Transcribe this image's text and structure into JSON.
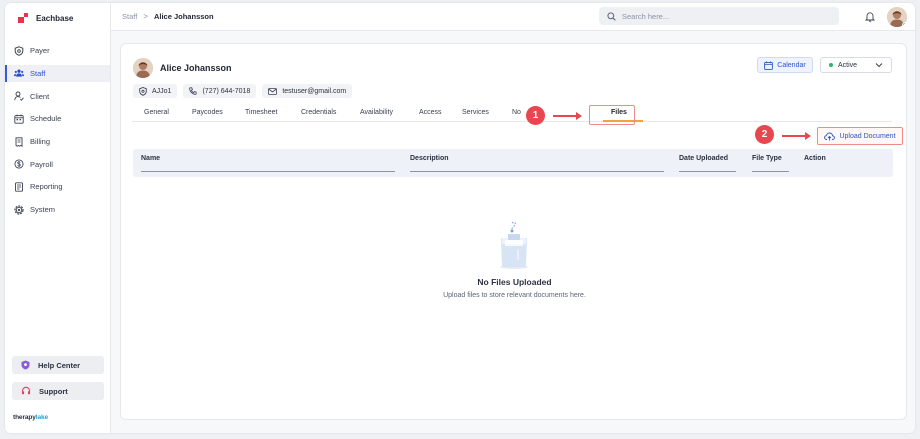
{
  "app": {
    "brand": "Eachbase"
  },
  "sidebar": {
    "items": [
      {
        "label": "Payer",
        "icon": "shield-icon",
        "active": false
      },
      {
        "label": "Staff",
        "icon": "users-icon",
        "active": true
      },
      {
        "label": "Client",
        "icon": "client-icon",
        "active": false
      },
      {
        "label": "Schedule",
        "icon": "calendar-icon",
        "active": false
      },
      {
        "label": "Billing",
        "icon": "billing-icon",
        "active": false
      },
      {
        "label": "Payroll",
        "icon": "payroll-icon",
        "active": false
      },
      {
        "label": "Reporting",
        "icon": "report-icon",
        "active": false
      },
      {
        "label": "System",
        "icon": "gear-icon",
        "active": false
      }
    ],
    "help_center": "Help Center",
    "support": "Support",
    "footer_logo_a": "therapy",
    "footer_logo_b": "lake"
  },
  "topbar": {
    "breadcrumb_parent": "Staff",
    "breadcrumb_sep": ">",
    "breadcrumb_current": "Alice Johansson",
    "search_placeholder": "Search here..."
  },
  "profile": {
    "name": "Alice Johansson",
    "id": "AJJo1",
    "phone": "(727) 644-7018",
    "email": "testuser@gmail.com",
    "calendar_label": "Calendar",
    "status": "Active"
  },
  "tabs": [
    {
      "label": "General"
    },
    {
      "label": "Paycodes"
    },
    {
      "label": "Timesheet"
    },
    {
      "label": "Credentials"
    },
    {
      "label": "Availability"
    },
    {
      "label": "Access"
    },
    {
      "label": "Services"
    },
    {
      "label": "No"
    },
    {
      "label": "Files",
      "active": true
    }
  ],
  "upload_button": "Upload Document",
  "annotations": {
    "marker1": "1",
    "marker2": "2"
  },
  "table": {
    "columns": [
      "Name",
      "Description",
      "Date Uploaded",
      "File Type",
      "Action"
    ]
  },
  "empty": {
    "title": "No Files Uploaded",
    "subtitle": "Upload files to store relevant documents here."
  },
  "colors": {
    "accent": "#2a56c6",
    "active_tab": "#f5a23c",
    "annotation": "#e8474f",
    "status": "#2fb36a"
  }
}
